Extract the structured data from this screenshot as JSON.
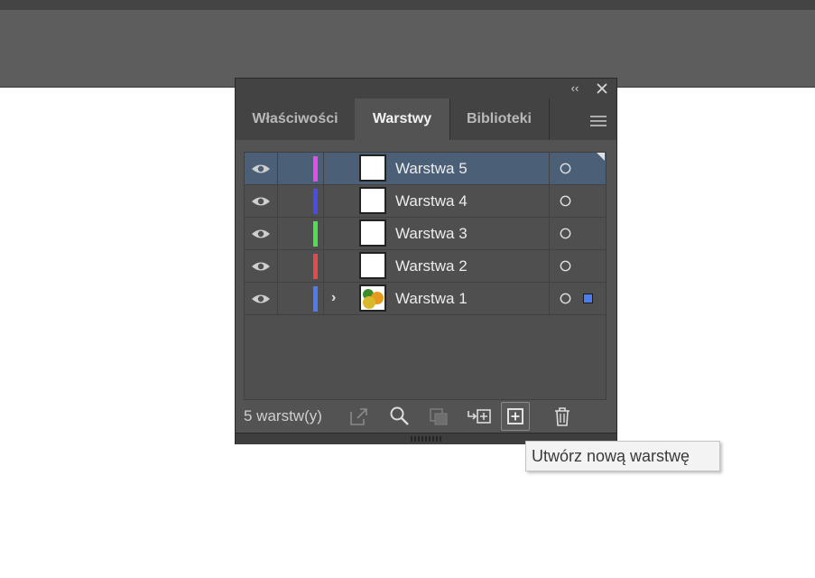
{
  "panel": {
    "collapse_label": "‹‹",
    "tabs": [
      {
        "label": "Właściwości",
        "active": false
      },
      {
        "label": "Warstwy",
        "active": true
      },
      {
        "label": "Biblioteki",
        "active": false
      }
    ],
    "layers": [
      {
        "name": "Warstwa 5",
        "color": "#e54ce8",
        "selected": true,
        "expandable": false,
        "thumbnail": "blank"
      },
      {
        "name": "Warstwa 4",
        "color": "#4b4bea",
        "selected": false,
        "expandable": false,
        "thumbnail": "blank"
      },
      {
        "name": "Warstwa 3",
        "color": "#4fe050",
        "selected": false,
        "expandable": false,
        "thumbnail": "blank"
      },
      {
        "name": "Warstwa 2",
        "color": "#e54949",
        "selected": false,
        "expandable": false,
        "thumbnail": "blank"
      },
      {
        "name": "Warstwa 1",
        "color": "#4d7cf0",
        "selected": false,
        "expandable": true,
        "thumbnail": "artwork"
      }
    ],
    "chevron": "›",
    "footer": {
      "count_label": "5 warstw(y)",
      "icons": [
        "export-icon",
        "search-icon",
        "clipping-mask-icon",
        "move-to-new-layer-icon",
        "new-layer-icon",
        "trash-icon"
      ]
    }
  },
  "tooltip": {
    "text": "Utwórz nową warstwę"
  },
  "colors": {
    "selected_row": "#4b6077",
    "panel_bg": "#535353"
  }
}
